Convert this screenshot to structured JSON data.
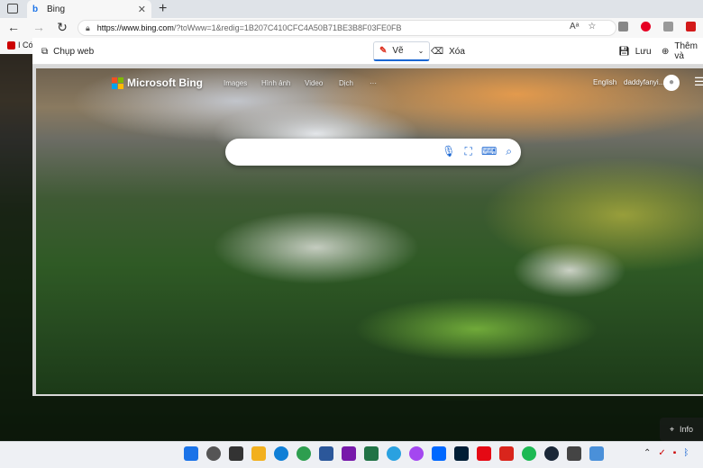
{
  "browser": {
    "tab_title": "Bing",
    "url_host": "https://www.bing.com",
    "url_path": "/?toWww=1&redig=1B207C410CFC4A50B71BE3B8F03FE0FB",
    "fav_item": "I Có"
  },
  "capture": {
    "web_capture_label": "Chụp web",
    "draw_label": "Vẽ",
    "erase_label": "Xóa",
    "save_label": "Lưu",
    "add_label": "Thêm và"
  },
  "bing": {
    "brand": "Microsoft Bing",
    "nav": [
      "Images",
      "Hình ảnh",
      "Video",
      "Dịch",
      "···"
    ],
    "language": "English",
    "user": "daddyfanyi..."
  },
  "overlay": {
    "info_label": "Info"
  },
  "icons": {
    "bing_favicon": "bing-icon",
    "search": "search-icon",
    "mic": "microphone-icon",
    "visual_search": "visual-search-icon",
    "keyboard": "keyboard-icon"
  }
}
